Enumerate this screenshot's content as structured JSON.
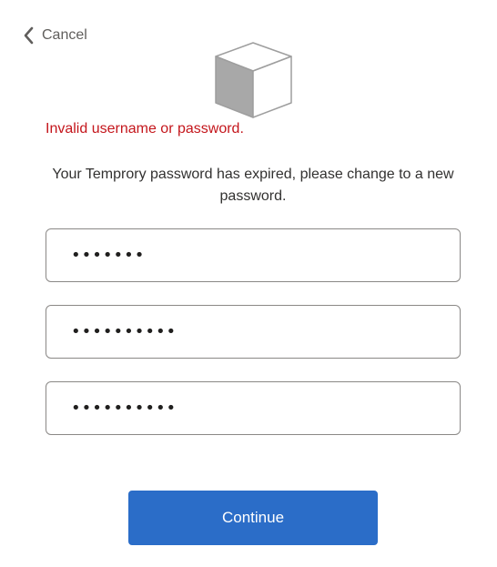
{
  "header": {
    "cancel_label": "Cancel",
    "cancel_icon": "chevron-left-icon",
    "logo_icon": "cube-logo-icon"
  },
  "form": {
    "error_text": "Invalid username or password.",
    "message": "Your Temprory password has expired, please change to a new password.",
    "fields": [
      {
        "value": "•••••••"
      },
      {
        "value": "••••••••••"
      },
      {
        "value": "••••••••••"
      }
    ],
    "continue_label": "Continue"
  },
  "colors": {
    "error": "#c4161c",
    "primary_button": "#2b6dc8",
    "field_border": "#8a8886"
  }
}
